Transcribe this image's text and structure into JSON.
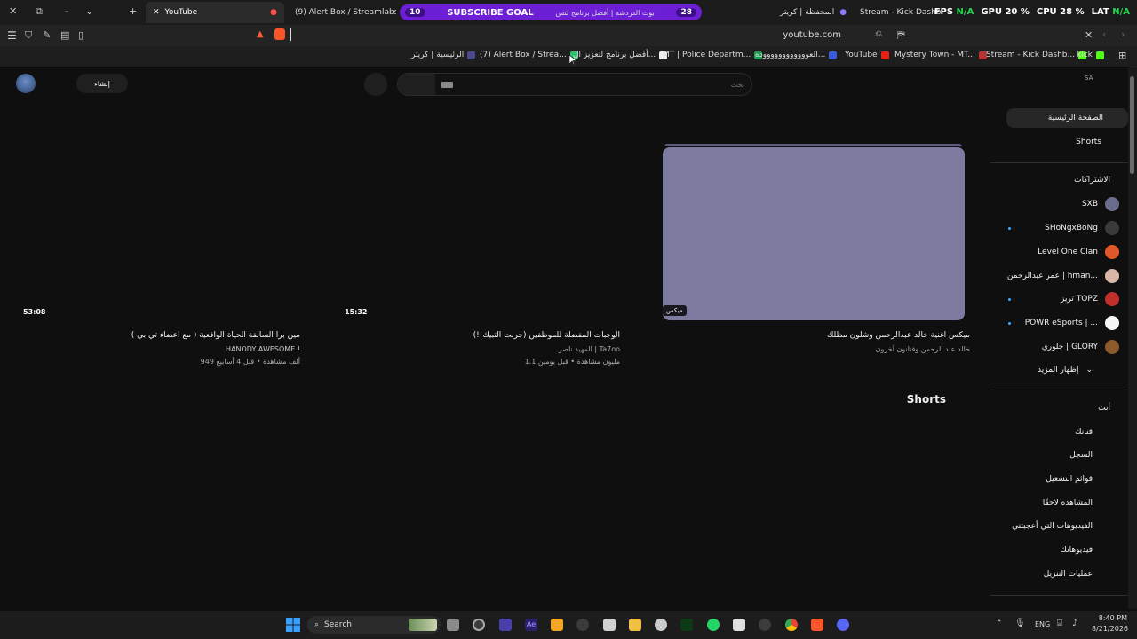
{
  "tabs": [
    {
      "label": "YouTube",
      "active": true
    },
    {
      "label": "(9) Alert Box / Streamlabs",
      "active": false
    },
    {
      "label": "بوت الدردشة | أفضل برنامج لتس",
      "active": false
    },
    {
      "label": "المحفظة | كريتر",
      "active": false
    },
    {
      "label": "Stream - Kick Dashboard",
      "active": false
    }
  ],
  "goal": {
    "left": "10",
    "label": "SUBSCRIBE GOAL",
    "right": "28"
  },
  "stats": {
    "fps": "FPS",
    "fps_val": "N/A",
    "gpu": "GPU",
    "gpu_val": "20 %",
    "cpu": "CPU",
    "cpu_val": "28 %",
    "lat": "LAT",
    "lat_val": "N/A"
  },
  "address": {
    "url": "youtube.com"
  },
  "bookmarks": [
    {
      "label": "الرئيسية | كريتر",
      "color": "#4a4a8a"
    },
    {
      "label": "(7) Alert Box / Strea...",
      "color": "#2fbf71"
    },
    {
      "label": "أفضل برنامج لتعزيز ال...",
      "color": "#eeeeee"
    },
    {
      "label": "MT | Police Departm...",
      "color": "#1f9d55"
    },
    {
      "label": "العووووووووووووده...",
      "color": "#3b5bdb"
    },
    {
      "label": "YouTube",
      "color": "#e62117"
    },
    {
      "label": "Mystery Town - MT...",
      "color": "#b83232"
    },
    {
      "label": "Stream - Kick Dashb...",
      "color": "#53fc18"
    },
    {
      "label": "kick",
      "color": "#53fc18"
    }
  ],
  "youtube": {
    "create_label": "إنشاء",
    "search_placeholder": "بحث",
    "country": "SA"
  },
  "sidebar": {
    "home": "الصفحة الرئيسية",
    "shorts": "Shorts",
    "subs_header": "الاشتراكات",
    "subscriptions": [
      {
        "name": "SXB",
        "color": "#6c6c8c"
      },
      {
        "name": "SHoNgxBoNg",
        "color": "#3a3a3a"
      },
      {
        "name": "Level One Clan",
        "color": "#e0582a"
      },
      {
        "name": "عمر عبدالرحمن | hman...",
        "color": "#d9b8a8"
      },
      {
        "name": "تريز TOPZ",
        "color": "#c0302b"
      },
      {
        "name": "POWR eSports | ...",
        "color": "#f5f5f5"
      },
      {
        "name": "جلوري | GLORY",
        "color": "#8c5a2b"
      }
    ],
    "show_more": "إظهار المزيد",
    "you_header": "أنت",
    "you_items": [
      "قناتك",
      "السجل",
      "قوائم التشغيل",
      "المشاهدة لاحقًا",
      "الفيديوهات التي أعجبتني",
      "فيديوهاتك",
      "عمليات التنزيل"
    ]
  },
  "videos": [
    {
      "title": "ميكس اغنية خالد عبدالرحمن وشلون مظلك",
      "channel": "خالد عبد الرحمن وفنانون آخرون",
      "meta": "",
      "duration": "",
      "badge": "ميكس"
    },
    {
      "title": "الوجبات المفضلة للموظفين (جربت التبيك!!)",
      "channel": "المهيد ناصر | Ta7oo",
      "meta": "1.1 مليون مشاهدة • قبل يومين",
      "duration": "15:32",
      "badge": ""
    },
    {
      "title": "مين برا السالفة الحياة الواقعية ( مع اعضاء تي بي )",
      "channel": "HANODY AWESOME !",
      "meta": "949 ألف مشاهدة • قبل 4 أسابيع",
      "duration": "53:08",
      "badge": ""
    }
  ],
  "shorts_heading": "Shorts",
  "taskbar": {
    "search": "Search",
    "lang": "ENG",
    "time": "8:40 PM",
    "date": "8/21/2026"
  }
}
